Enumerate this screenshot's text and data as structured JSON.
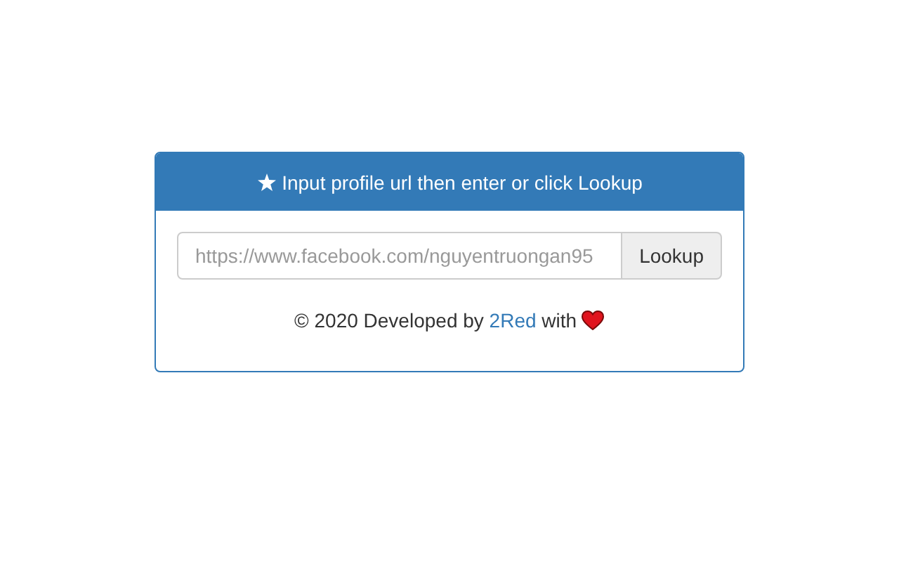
{
  "panel": {
    "title": "Input profile url then enter or click Lookup"
  },
  "search": {
    "placeholder": "https://www.facebook.com/nguyentruongan95",
    "button": "Lookup"
  },
  "footer": {
    "before": "© 2020 Developed by",
    "link": "2Red",
    "after": "with"
  }
}
